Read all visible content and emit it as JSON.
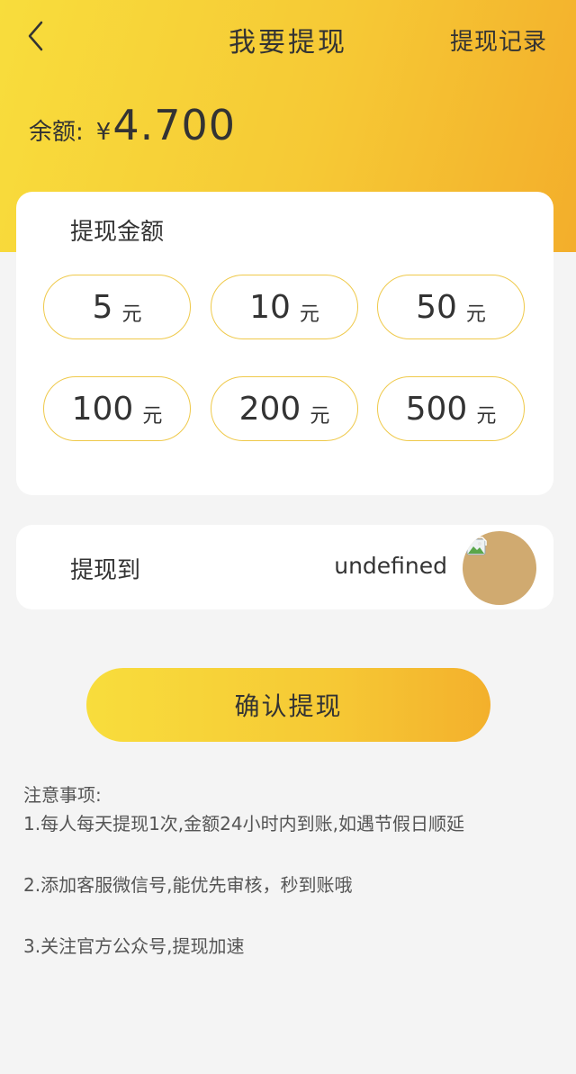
{
  "nav": {
    "title": "我要提现",
    "record_label": "提现记录"
  },
  "balance": {
    "label": "余额:",
    "currency": "¥",
    "amount": "4.700"
  },
  "amount_section": {
    "title": "提现金额",
    "unit": "元",
    "options": [
      {
        "value": "5"
      },
      {
        "value": "10"
      },
      {
        "value": "50"
      },
      {
        "value": "100"
      },
      {
        "value": "200"
      },
      {
        "value": "500"
      }
    ]
  },
  "destination": {
    "label": "提现到",
    "value": "undefined"
  },
  "confirm_label": "确认提现",
  "notes": {
    "title": "注意事项:",
    "items": [
      "1.每人每天提现1次,金额24小时内到账,如遇节假日顺延",
      "2.添加客服微信号,能优先审核，秒到账哦",
      "3.关注官方公众号,提现加速"
    ]
  },
  "colors": {
    "accent": "#f6c935",
    "option_border": "#efc94a",
    "page_bg": "#f4f4f4"
  }
}
